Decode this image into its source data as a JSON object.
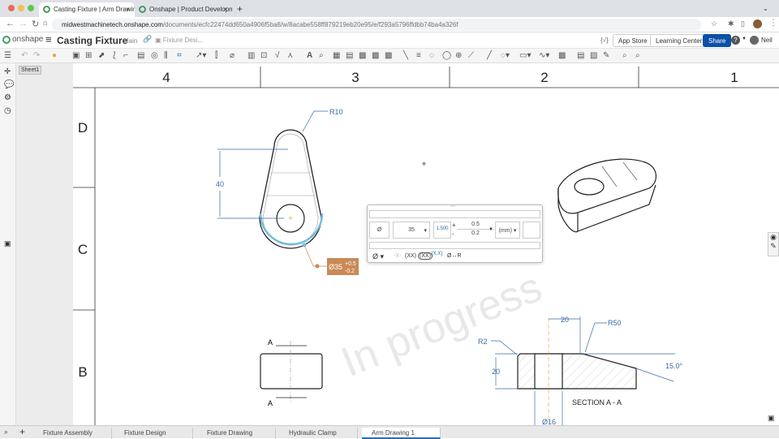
{
  "browser": {
    "tabs": [
      {
        "label": "Casting Fixture | Arm Drawing",
        "active": true
      },
      {
        "label": "Onshape | Product Developme",
        "active": false
      }
    ],
    "new_tab": "+",
    "close": "×",
    "url_host": "midwestmachinetech.onshape.com",
    "url_path": "/documents/ecfc22474dd650a4906f5ba8/w/8acabe558ff879219eb20e95/e/f293a5796ffdbb74ba4a326f"
  },
  "header": {
    "logo": "onshape",
    "doc_title": "Casting Fixture",
    "branch": "Main",
    "breadcrumb": "Fixture Desi...",
    "variables": "{√}",
    "app_store": "App Store",
    "learning_center": "Learning Center",
    "share": "Share",
    "help": "?",
    "user": "Neil"
  },
  "sheet_panel": {
    "sheets": [
      "Sheet1"
    ]
  },
  "drawing": {
    "zone_columns": [
      "4",
      "3",
      "2",
      "1"
    ],
    "zone_rows": [
      "D",
      "C",
      "B"
    ],
    "watermark": "In progress",
    "dims": {
      "r10": "R10",
      "d40": "40",
      "dia35": "Ø35",
      "tol_plus": "+0.5",
      "tol_minus": "-0.2",
      "sec_a": "A",
      "d20_top": "20",
      "r50": "R50",
      "r2": "R2",
      "d20_left": "20",
      "angle": "15.0°",
      "section_label": "SECTION A - A",
      "dia16": "Ø16"
    }
  },
  "dim_panel": {
    "symbol": "Ø",
    "value": "35",
    "plus_sign": "+",
    "minus_sign": "-",
    "tol_upper": "0.5",
    "tol_lower": "0.2",
    "units": "(mm)",
    "dia_btn": "Ø",
    "x_btn": "-X-",
    "paren_btn": "(XX)",
    "oval_btn": "(XX)",
    "box_btn": "[X.X]",
    "toR_btn": "Ø↔R",
    "tol_format": "1.500"
  },
  "bottom_tabs": [
    {
      "label": "Fixture Assembly"
    },
    {
      "label": "Fixture Design"
    },
    {
      "label": "Fixture Drawing"
    },
    {
      "label": "Hydraulic Clamp"
    },
    {
      "label": "Arm Drawing 1",
      "active": true
    }
  ],
  "colors": {
    "accent": "#0b4fa8",
    "dim": "#3a6aa8",
    "selected": "#6fbcdc",
    "highlight": "#c98a57"
  }
}
